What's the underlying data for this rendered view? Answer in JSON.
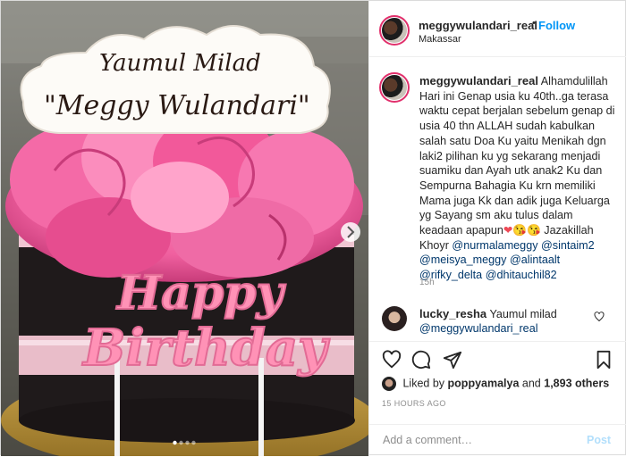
{
  "colors": {
    "accent": "#0095f6",
    "link": "#00376b",
    "muted": "#8e8e8e",
    "heart": "#ed4956"
  },
  "media": {
    "topper_line1": "Yaumul Milad",
    "topper_line2": "\"Meggy Wulandari\"",
    "cake_text_line1": "Happy",
    "cake_text_line2": "Birthday",
    "carousel_dots": 4,
    "active_dot": 1,
    "next_icon": "chevron-right-icon"
  },
  "header": {
    "username": "meggywulandari_real",
    "separator": "•",
    "follow_label": "Follow",
    "location": "Makassar"
  },
  "caption": {
    "username": "meggywulandari_real",
    "text": "Alhamdulillah Hari ini Genap usia ku 40th..ga terasa waktu cepat berjalan sebelum genap di usia 40 thn ALLAH sudah kabulkan salah satu Doa Ku yaitu Menikah dgn laki2 pilihan ku yg sekarang menjadi suamiku dan Ayah utk anak2 Ku dan Sempurna Bahagia Ku krn memiliki Mama juga Kk dan adik juga Keluarga yg Sayang sm aku tulus dalam keadaan apapun",
    "emoji": "❤😘😘",
    "text2": "Jazakillah Khoyr",
    "mentions": [
      "@nurmalameggy",
      "@sintaim2",
      "@meisya_meggy",
      "@alintaalt",
      "@rifky_delta",
      "@dhitauchil82"
    ],
    "time": "15h"
  },
  "comment": {
    "username": "lucky_resha",
    "text": "Yaumul milad",
    "mention": "@meggywulandari_real"
  },
  "actions": {
    "like_icon": "heart-icon",
    "comment_icon": "comment-icon",
    "share_icon": "send-icon",
    "save_icon": "bookmark-icon"
  },
  "likes": {
    "prefix": "Liked by",
    "user": "poppyamalya",
    "middle": "and",
    "count": "1,893 others"
  },
  "timestamp": "15 HOURS AGO",
  "add_comment": {
    "placeholder": "Add a comment…",
    "post_label": "Post"
  }
}
